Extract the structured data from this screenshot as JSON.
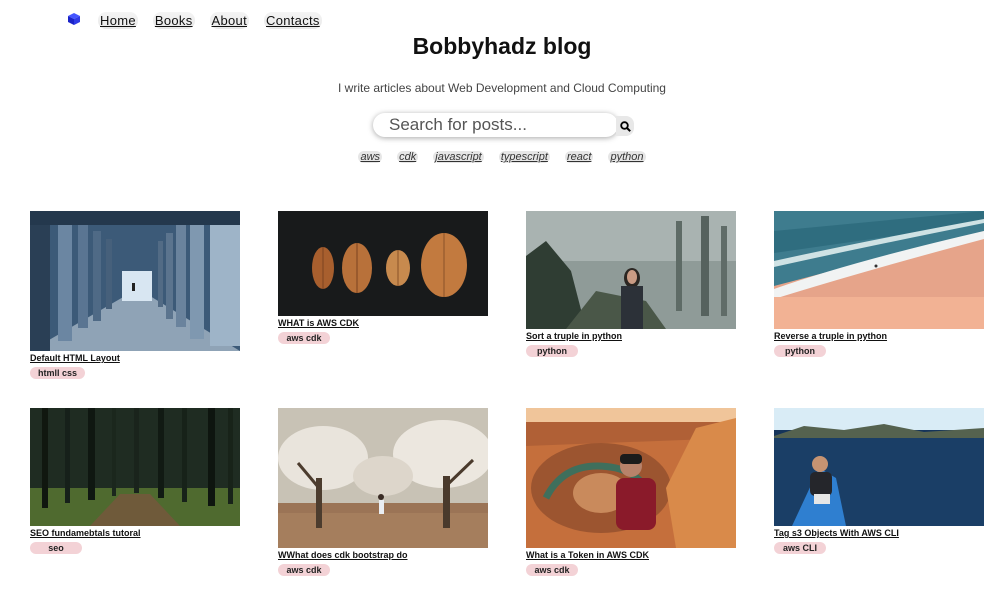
{
  "nav": {
    "items": [
      "Home",
      "Books",
      "About",
      "Contacts"
    ],
    "logo_icon": "cube-icon",
    "accent_color": "#2233dd"
  },
  "header": {
    "title": "Bobbyhadz blog",
    "subtitle": "I write articles about Web Development and Cloud Computing"
  },
  "search": {
    "placeholder": "Search for posts...",
    "button_icon": "search-icon"
  },
  "tags": [
    "aws",
    "cdk",
    "javascript",
    "typescript",
    "react",
    "python"
  ],
  "posts": [
    {
      "title": "Default HTML Layout",
      "tag": "htmll css",
      "image": "pillars-corridor-photo"
    },
    {
      "title": "WHAT is AWS CDK",
      "tag": "aws cdk",
      "image": "autumn-leaves-photo"
    },
    {
      "title": "Sort a truple in python",
      "tag": "python",
      "image": "foggy-forest-person-photo"
    },
    {
      "title": "Reverse a truple in python",
      "tag": "python",
      "image": "aerial-beach-waves-photo"
    },
    {
      "title": "SEO fundamebtals tutoral",
      "tag": "seo",
      "image": "dark-pine-forest-photo"
    },
    {
      "title": "WWhat does cdk bootstrap do",
      "tag": "aws cdk",
      "image": "blossom-trees-photo"
    },
    {
      "title": "What is a Token in AWS CDK",
      "tag": "aws cdk",
      "image": "canyon-horseshoe-photo"
    },
    {
      "title": "Tag s3 Objects With AWS CLI",
      "tag": "aws CLI",
      "image": "kayak-lake-photo"
    }
  ]
}
